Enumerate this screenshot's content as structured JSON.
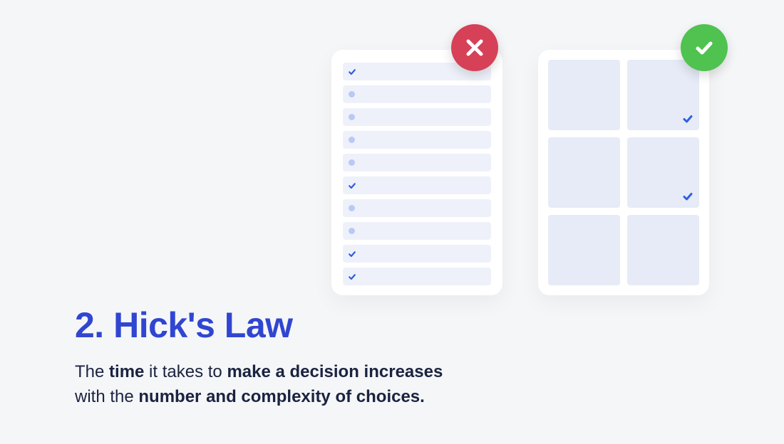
{
  "heading": "2. Hick's Law",
  "description_parts": {
    "p1": "The ",
    "p2": "time",
    "p3": " it takes to ",
    "p4": "make a decision increases",
    "p5": "with the ",
    "p6": "number and complexity of choices."
  },
  "list_card": {
    "row_count": 10,
    "checked_indices": [
      0,
      5,
      8,
      9
    ]
  },
  "grid_card": {
    "cell_count": 6,
    "checked_indices": [
      1,
      3
    ]
  },
  "badges": {
    "bad": "x",
    "good": "check"
  },
  "colors": {
    "heading": "#3046d1",
    "bad_badge": "#d64157",
    "good_badge": "#4fc24f",
    "check_blue": "#2f5fe0"
  }
}
